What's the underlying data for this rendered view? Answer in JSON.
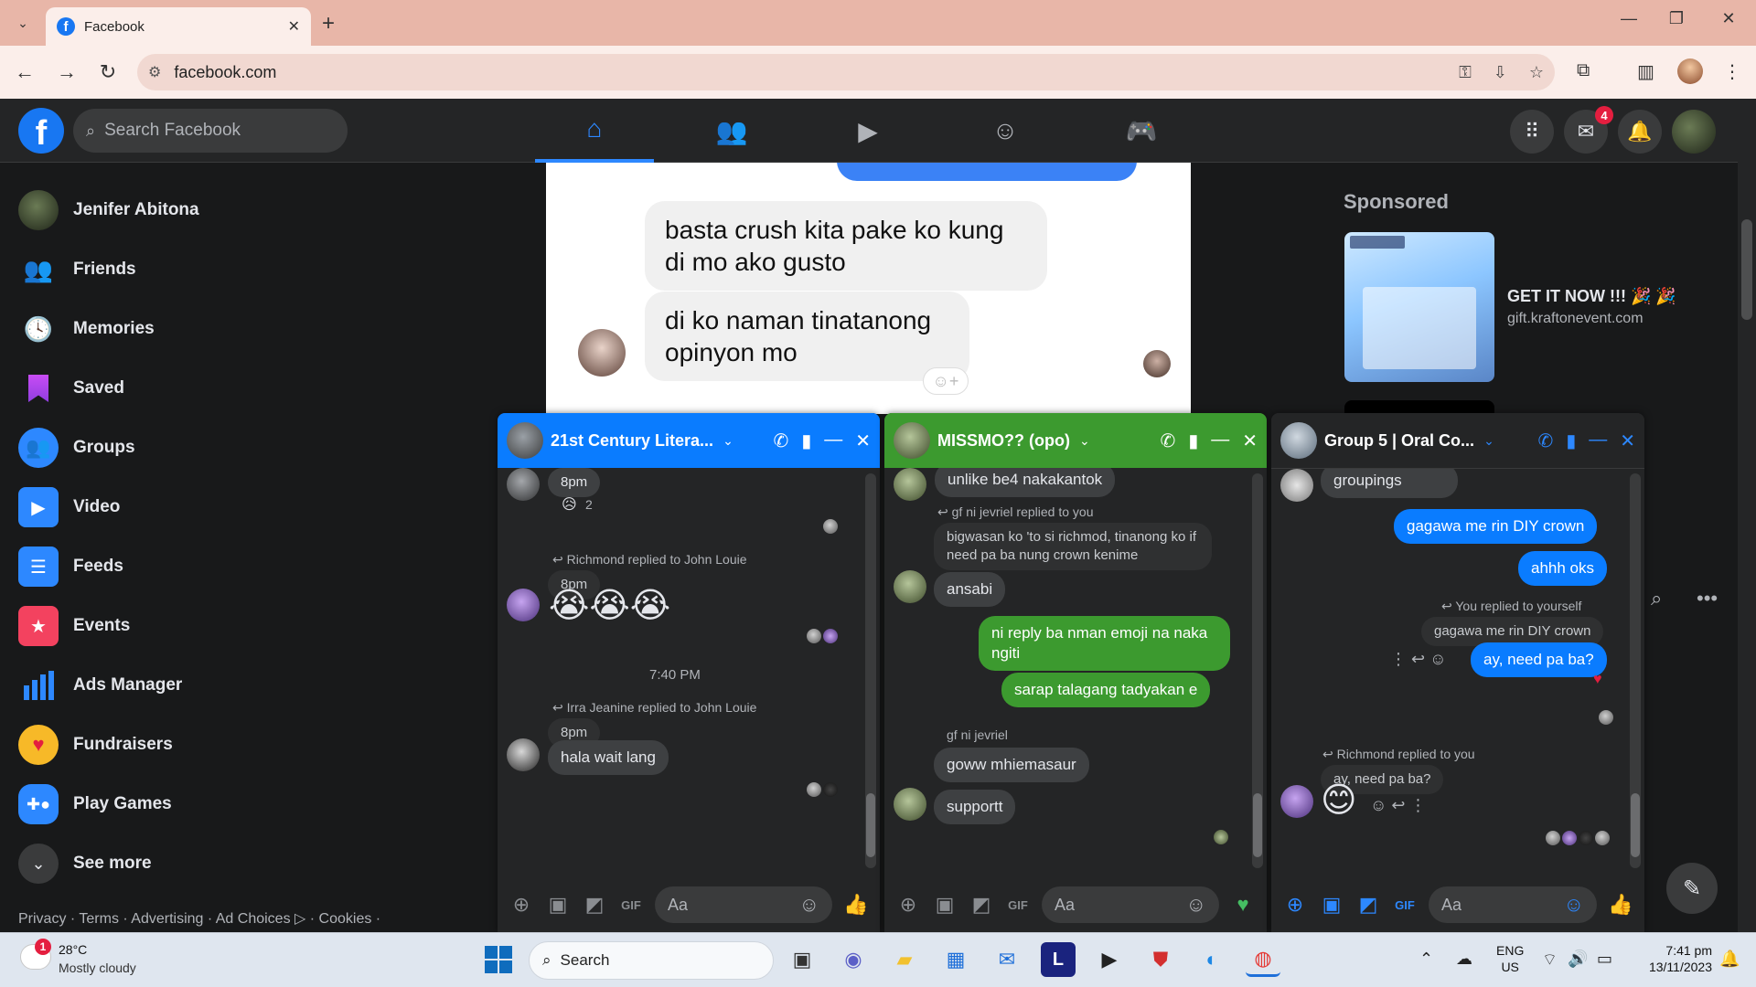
{
  "browser": {
    "tab_title": "Facebook",
    "url": "facebook.com"
  },
  "fb": {
    "search_placeholder": "Search Facebook",
    "messenger_badge": "4"
  },
  "sidebar": {
    "items": [
      {
        "label": "Jenifer Abitona",
        "icon": "profile-avatar"
      },
      {
        "label": "Friends",
        "icon": "friends-icon"
      },
      {
        "label": "Memories",
        "icon": "clock-icon"
      },
      {
        "label": "Saved",
        "icon": "bookmark-icon"
      },
      {
        "label": "Groups",
        "icon": "groups-icon"
      },
      {
        "label": "Video",
        "icon": "play-icon"
      },
      {
        "label": "Feeds",
        "icon": "feeds-icon"
      },
      {
        "label": "Events",
        "icon": "calendar-icon"
      },
      {
        "label": "Ads Manager",
        "icon": "bar-chart-icon"
      },
      {
        "label": "Fundraisers",
        "icon": "heart-icon"
      },
      {
        "label": "Play Games",
        "icon": "gamepad-icon"
      },
      {
        "label": "See more",
        "icon": "chevron-down-icon"
      }
    ],
    "footer": "Privacy · Terms · Advertising · Ad Choices ▷ · Cookies ·"
  },
  "post": {
    "bubble1": "basta crush kita pake ko kung di mo ako gusto",
    "bubble2": "di ko naman tinatanong opinyon mo"
  },
  "sponsored": {
    "heading": "Sponsored",
    "title": "GET IT NOW !!! 🎉 🎉",
    "url": "gift.kraftonevent.com"
  },
  "chats": {
    "c1": {
      "name": "21st Century Litera...",
      "color": "#0a7cff",
      "m1_time": "8pm",
      "m1_react_count": "2",
      "reply1_meta": "Richmond replied to John Louie",
      "reply1_quote": "8pm",
      "reply1_emoji": "😭😭😭",
      "divider": "7:40 PM",
      "reply2_meta": "Irra Jeanine replied to John Louie",
      "reply2_quote": "8pm",
      "reply2_text": "hala wait lang",
      "input_placeholder": "Aa"
    },
    "c2": {
      "name": "MISSMO?? (opo)",
      "color": "#3c9a2f",
      "m_top": "unlike be4 nakakantok",
      "reply_meta": "gf ni jevriel replied to you",
      "reply_quote": "bigwasan ko 'to si richmod, tinanong ko if need pa ba nung crown kenime",
      "m_ansabi": "ansabi",
      "m_out1": "ni reply ba nman emoji na naka ngiti",
      "m_out2": "sarap talagang tadyakan e",
      "sender": "gf ni jevriel",
      "m_in1": "goww mhiemasaur",
      "m_in2": "supportt",
      "input_placeholder": "Aa"
    },
    "c3": {
      "name": "Group 5 | Oral Co...",
      "color": "#0a7cff",
      "m_top": "groupings",
      "m_out1": "gagawa me rin DIY crown",
      "m_out2": "ahhh oks",
      "self_meta": "You replied to yourself",
      "self_quote": "gagawa me rin DIY crown",
      "self_reply": "ay, need pa ba?",
      "reply_meta": "Richmond replied to you",
      "reply_quote": "ay, need pa ba?",
      "reply_emoji": "😊",
      "input_placeholder": "Aa"
    }
  },
  "taskbar": {
    "temp": "28°C",
    "weather": "Mostly cloudy",
    "weather_badge": "1",
    "search": "Search",
    "lang1": "ENG",
    "lang2": "US",
    "time": "7:41 pm",
    "date": "13/11/2023"
  }
}
